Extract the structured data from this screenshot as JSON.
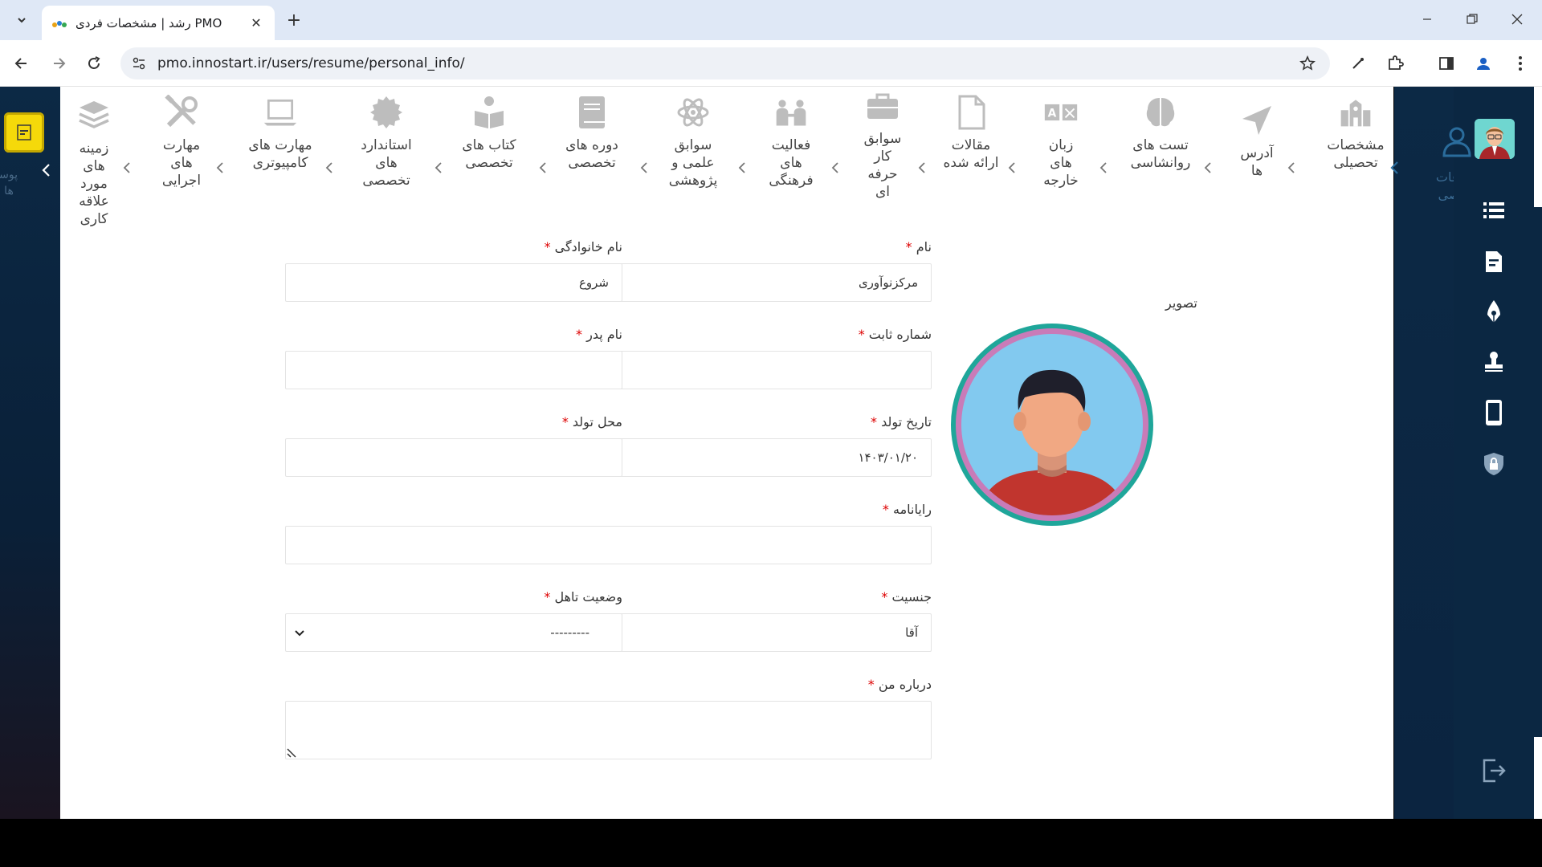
{
  "browser": {
    "tab_title": "رشد | مشخصات فردی PMO",
    "url": "pmo.innostart.ir/users/resume/personal_info/",
    "tab_close": "✕",
    "new_tab": "+"
  },
  "left_panel": {
    "faint_text": "پوسـ ها"
  },
  "steps": [
    {
      "label": "مشخصات تحصیلی",
      "icon": "building-icon"
    },
    {
      "label": "آدرس ها",
      "icon": "send-icon"
    },
    {
      "label": "تست های روانشاسی",
      "icon": "brain-icon"
    },
    {
      "label": "زبان های خارجه",
      "icon": "translate-icon"
    },
    {
      "label": "مقالات ارائه شده",
      "icon": "document-icon"
    },
    {
      "label": "سوابق کار حرفه ای",
      "icon": "briefcase-icon"
    },
    {
      "label": "فعالیت های فرهنگی",
      "icon": "people-icon"
    },
    {
      "label": "سوابق علمی و پژوهشی",
      "icon": "atom-icon"
    },
    {
      "label": "دوره های تخصصی",
      "icon": "book-icon"
    },
    {
      "label": "کتاب های تخصصی",
      "icon": "reader-icon"
    },
    {
      "label": "استاندارد های تخصصی",
      "icon": "badge-icon"
    },
    {
      "label": "مهارت های کامپیوتری",
      "icon": "laptop-icon"
    },
    {
      "label": "مهارت های اجرایی",
      "icon": "tools-icon"
    },
    {
      "label": "زمینه های مورد علاقه کاری",
      "icon": "layers-icon"
    }
  ],
  "form": {
    "photo_label": "تصویر",
    "first_name": {
      "label": "نام",
      "value": "مرکزنوآوری"
    },
    "last_name": {
      "label": "نام خانوادگی",
      "value": "شروع"
    },
    "phone": {
      "label": "شماره ثابت",
      "value": ""
    },
    "father_name": {
      "label": "نام پدر",
      "value": ""
    },
    "birth_date": {
      "label": "تاریخ تولد",
      "value": "۱۴۰۳/۰۱/۲۰"
    },
    "birth_place": {
      "label": "محل تولد",
      "value": ""
    },
    "email": {
      "label": "رایانامه",
      "value": ""
    },
    "gender": {
      "label": "جنسیت",
      "value": "آقا"
    },
    "marital": {
      "label": "وضعیت تاهل",
      "value": "---------"
    },
    "about": {
      "label": "درباره من",
      "value": ""
    },
    "required_mark": "*"
  },
  "right_sidebar": {
    "faint_text": "اطلاعات شخصی"
  },
  "colors": {
    "accent_teal": "#1fa69a",
    "avatar_ring": "#c97bb8",
    "avatar_bg": "#82c9ef",
    "sidebar_bg": "#0b2742",
    "sticky": "#f5d90a"
  }
}
